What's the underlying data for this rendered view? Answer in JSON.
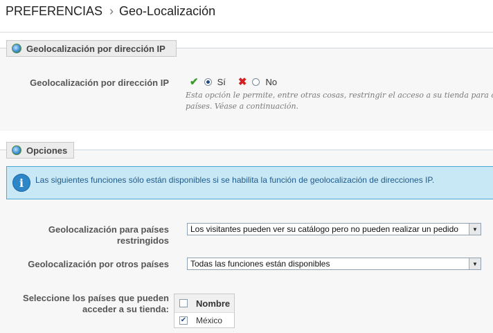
{
  "breadcrumb": {
    "section": "PREFERENCIAS",
    "page": "Geo-Localización"
  },
  "panel_ip": {
    "legend": "Geolocalización por dirección IP",
    "field_label": "Geolocalización por dirección IP",
    "yes_label": "Sí",
    "no_label": "No",
    "selected": "Sí",
    "hint_line1": "Esta opción le permite, entre otras cosas, restringir el acceso a su tienda para cie",
    "hint_line2": "países. Véase a continuación."
  },
  "panel_options": {
    "legend": "Opciones",
    "info": "Las siguientes funciones sólo están disponibles si se habilita la función de geolocalización de direcciones IP.",
    "restricted_label_1": "Geolocalización para países",
    "restricted_label_2": "restringidos",
    "restricted_value": "Los visitantes pueden ver su catálogo pero no pueden realizar un pedido",
    "other_label": "Geolocalización por otros países",
    "other_value": "Todas las funciones están disponibles",
    "countries_label_1": "Seleccione los países que pueden",
    "countries_label_2": "acceder a su tienda:",
    "countries_header": "Nombre",
    "countries": [
      {
        "name": "México",
        "checked": true
      }
    ]
  },
  "icons": {
    "globe": "globe-icon",
    "check": "check-icon",
    "cross": "cross-icon",
    "info": "info-icon",
    "dropdown": "chevron-down-icon"
  },
  "colors": {
    "info_bg": "#c9e8f5",
    "info_border": "#4ba7d4",
    "info_text": "#1f5a8a",
    "check": "#3a9a2a",
    "cross": "#d42020"
  }
}
